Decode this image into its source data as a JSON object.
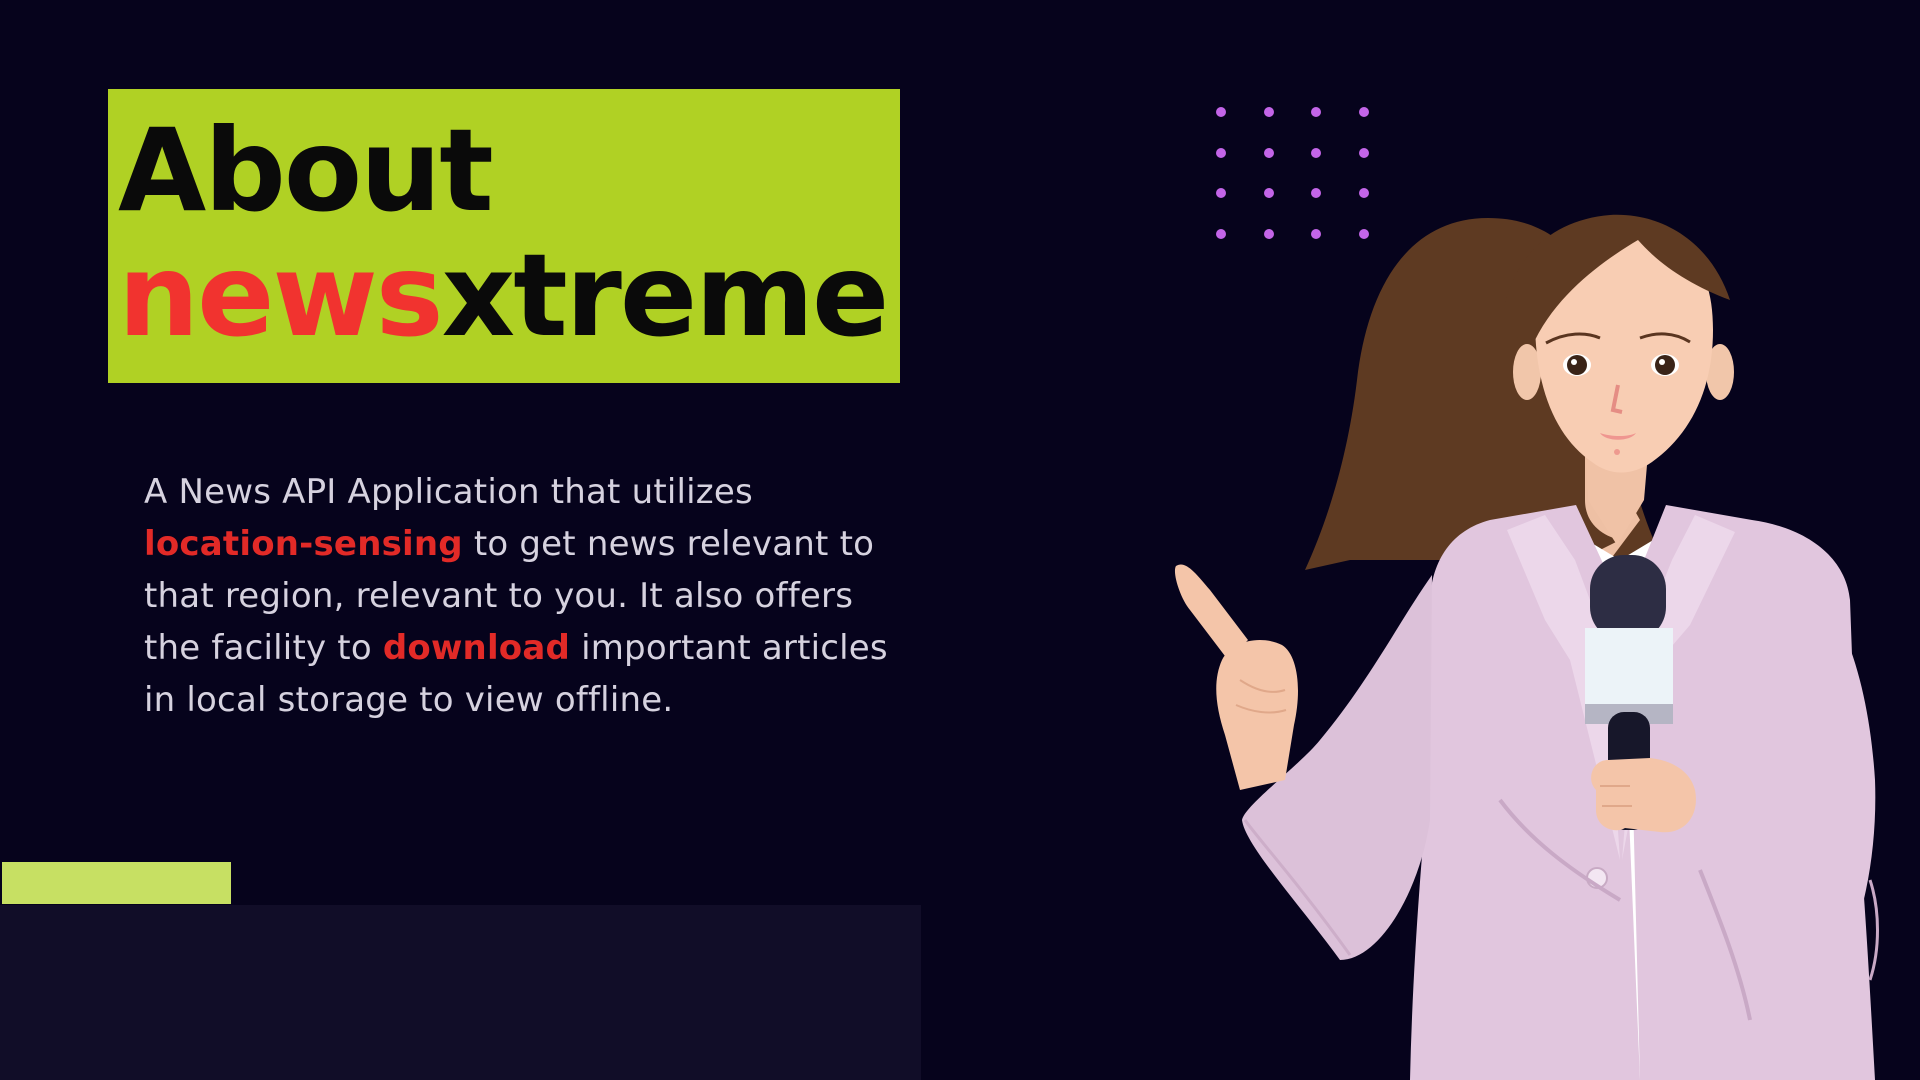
{
  "title": {
    "line1": "About",
    "line2_highlight": "news",
    "line2_rest": "xtreme"
  },
  "description": {
    "part1": "A News API Application that utilizes ",
    "highlight1": "location-sensing",
    "part2": " to get news relevant to that region, relevant to you. It also offers the facility to ",
    "highlight2": "download",
    "part3": " important  articles in local storage to view offline."
  },
  "colors": {
    "background": "#06031c",
    "title_box": "#b0d124",
    "title_text": "#0a0a0a",
    "accent_red": "#f1332f",
    "body_text": "#d6d2df",
    "accent_bar": "#c7e063",
    "footer_panel": "#110d28",
    "dots": "#c365e8"
  },
  "illustration": {
    "icon": "news-reporter-with-microphone-icon"
  }
}
